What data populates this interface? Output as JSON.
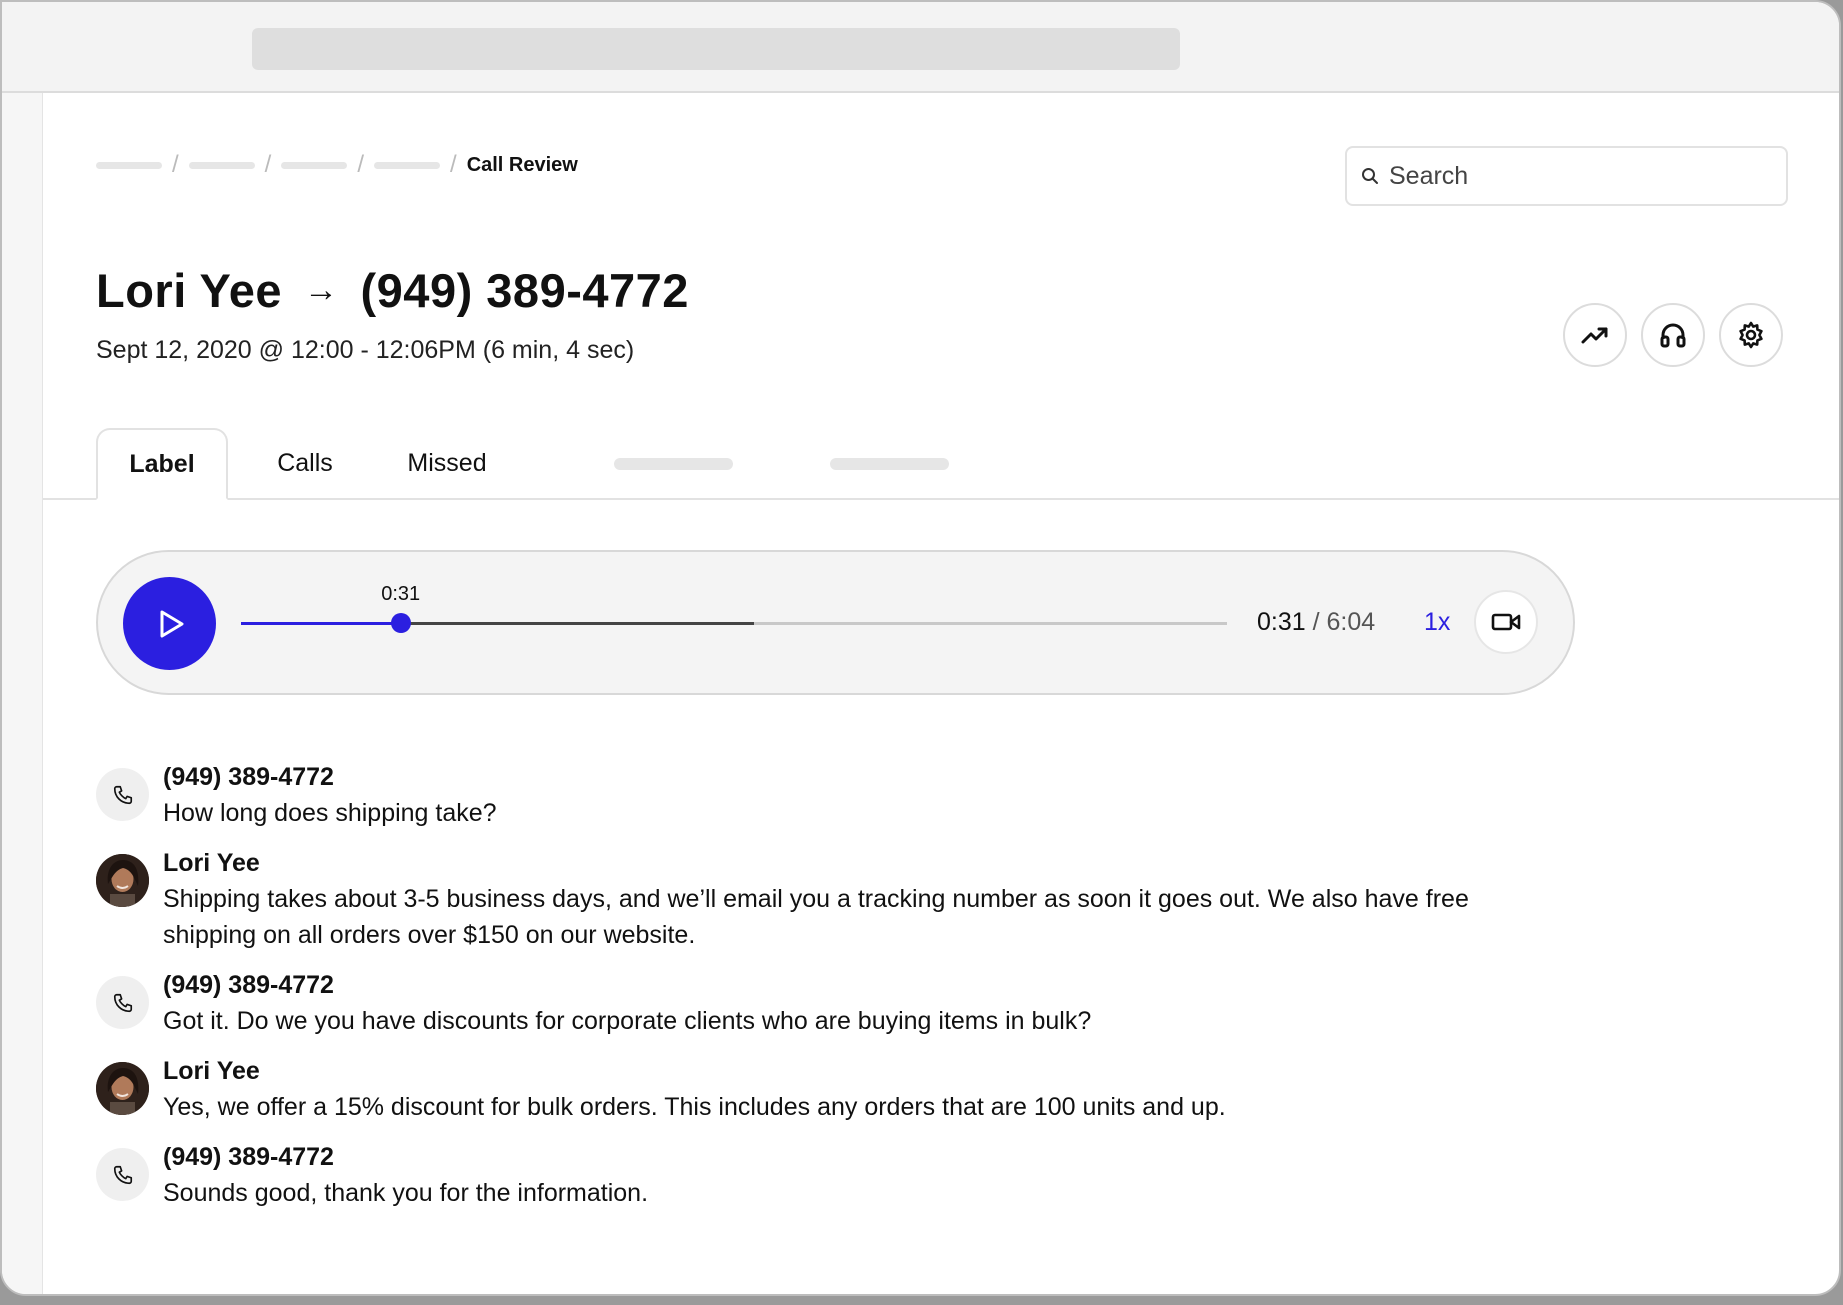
{
  "breadcrumb": {
    "current": "Call Review"
  },
  "search": {
    "placeholder": "Search"
  },
  "call": {
    "caller": "Lori Yee",
    "arrow": "→",
    "number": "(949) 389-4772",
    "datetime": "Sept 12, 2020 @ 12:00 - 12:06PM (6 min, 4 sec)"
  },
  "actions": {
    "trend_icon": "trend-up-icon",
    "headset_icon": "headphones-icon",
    "settings_icon": "gear-icon"
  },
  "tabs": [
    {
      "label": "Label",
      "active": true
    },
    {
      "label": "Calls",
      "active": false
    },
    {
      "label": "Missed",
      "active": false
    }
  ],
  "player": {
    "tooltip": "0:31",
    "current": "0:31",
    "separator": " / ",
    "duration": "6:04",
    "speed": "1x",
    "played_fraction": 0.162,
    "buffered_fraction": 0.52,
    "accent_color": "#2b1fe0"
  },
  "transcript": [
    {
      "speaker": "(949) 389-4772",
      "type": "phone",
      "text": "How long does shipping take?"
    },
    {
      "speaker": "Lori Yee",
      "type": "agent",
      "text": "Shipping takes about 3-5 business days, and we’ll email you a tracking number as soon it goes out. We also have free shipping on all orders over $150 on our website."
    },
    {
      "speaker": "(949) 389-4772",
      "type": "phone",
      "text": "Got it. Do we you have discounts for corporate clients who are buying items in bulk?"
    },
    {
      "speaker": "Lori Yee",
      "type": "agent",
      "text": "Yes, we offer a 15% discount for bulk orders. This includes any orders that are 100 units and up."
    },
    {
      "speaker": "(949) 389-4772",
      "type": "phone",
      "text": "Sounds good, thank you for the information."
    }
  ]
}
